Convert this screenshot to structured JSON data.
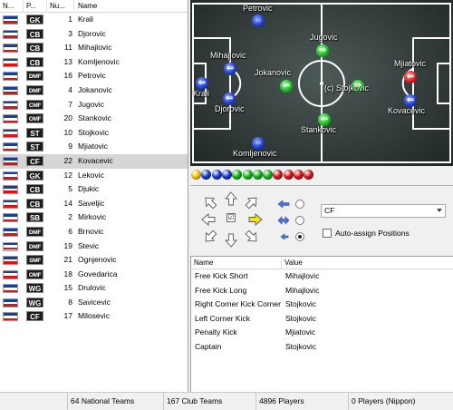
{
  "list": {
    "headers": [
      "N...",
      "P...",
      "Nu...",
      "Name"
    ],
    "selected_index": 10,
    "players": [
      {
        "pos": "GK",
        "num": "1",
        "name": "Krali"
      },
      {
        "pos": "CB",
        "num": "3",
        "name": "Djorovic"
      },
      {
        "pos": "CB",
        "num": "11",
        "name": "Mihajlovic"
      },
      {
        "pos": "CB",
        "num": "13",
        "name": "Komljenovic"
      },
      {
        "pos": "DMF",
        "num": "16",
        "name": "Petrovic"
      },
      {
        "pos": "DMF",
        "num": "4",
        "name": "Jokanovic"
      },
      {
        "pos": "CMF",
        "num": "7",
        "name": "Jugovic"
      },
      {
        "pos": "OMF",
        "num": "20",
        "name": "Stankovic"
      },
      {
        "pos": "ST",
        "num": "10",
        "name": "Stojkovic"
      },
      {
        "pos": "ST",
        "num": "9",
        "name": "Mjiatovic"
      },
      {
        "pos": "CF",
        "num": "22",
        "name": "Kovacevic"
      },
      {
        "pos": "GK",
        "num": "12",
        "name": "Lekovic"
      },
      {
        "pos": "CB",
        "num": "5",
        "name": "Djukic"
      },
      {
        "pos": "CB",
        "num": "14",
        "name": "Saveljic"
      },
      {
        "pos": "SB",
        "num": "2",
        "name": "Mirkovic"
      },
      {
        "pos": "DMF",
        "num": "6",
        "name": "Brnovic"
      },
      {
        "pos": "DMF",
        "num": "19",
        "name": "Stevic"
      },
      {
        "pos": "SMF",
        "num": "21",
        "name": "Ognjenovic"
      },
      {
        "pos": "OMF",
        "num": "18",
        "name": "Govedarica"
      },
      {
        "pos": "WG",
        "num": "15",
        "name": "Drulovic"
      },
      {
        "pos": "WG",
        "num": "8",
        "name": "Savicevic"
      },
      {
        "pos": "CF",
        "num": "17",
        "name": "Milosevic"
      }
    ]
  },
  "pitch": {
    "markers": [
      {
        "name": "Petrovic",
        "color": "blue",
        "arrow": "⇔"
      },
      {
        "name": "Mihajlovic",
        "color": "blue",
        "arrow": "⇐"
      },
      {
        "name": "Jugovic",
        "color": "green",
        "arrow": "⇒"
      },
      {
        "name": "Jokanovic",
        "color": "green",
        "arrow": "⇐"
      },
      {
        "name": "Krali",
        "color": "blue",
        "arrow": "⇐"
      },
      {
        "name": "Djorovic",
        "color": "blue",
        "arrow": "⇐"
      },
      {
        "name": "(c) Stojkovic",
        "color": "green",
        "arrow": "⇒"
      },
      {
        "name": "Mjiatovic",
        "color": "red",
        "arrow": "⇐"
      },
      {
        "name": "Kovacevic",
        "color": "blue",
        "arrow": "⇐"
      },
      {
        "name": "Stankovic",
        "color": "green",
        "arrow": "⇐"
      },
      {
        "name": "Komljenovic",
        "color": "blue",
        "arrow": "⇔"
      }
    ]
  },
  "balls": [
    "#f5c400",
    "#1a37c9",
    "#1a37c9",
    "#1a37c9",
    "#16b31c",
    "#16b31c",
    "#16b31c",
    "#16b31c",
    "#d3161d",
    "#d3161d",
    "#d3161d",
    "#d3161d"
  ],
  "controls": {
    "position_value": "CF",
    "auto_assign_label": "Auto-assign Positions",
    "auto_assign_checked": false,
    "direction_checkbox": "☑"
  },
  "setpieces": {
    "headers": [
      "Name",
      "Value"
    ],
    "rows": [
      {
        "name": "Free Kick Short",
        "value": "Mihajlovic"
      },
      {
        "name": "Free Kick Long",
        "value": "Mihajlovic"
      },
      {
        "name": "Right Corner Kick Corner",
        "value": "Stojkovic"
      },
      {
        "name": "Left Corner Kick",
        "value": "Stojkovic"
      },
      {
        "name": "Penalty Kick",
        "value": "Mjiatovic"
      },
      {
        "name": "Captain",
        "value": "Stojkovic"
      }
    ]
  },
  "status": {
    "national_teams": "64 National Teams",
    "club_teams": "167 Club Teams",
    "players": "4896 Players",
    "nippon": "0 Players (Nippon)"
  }
}
